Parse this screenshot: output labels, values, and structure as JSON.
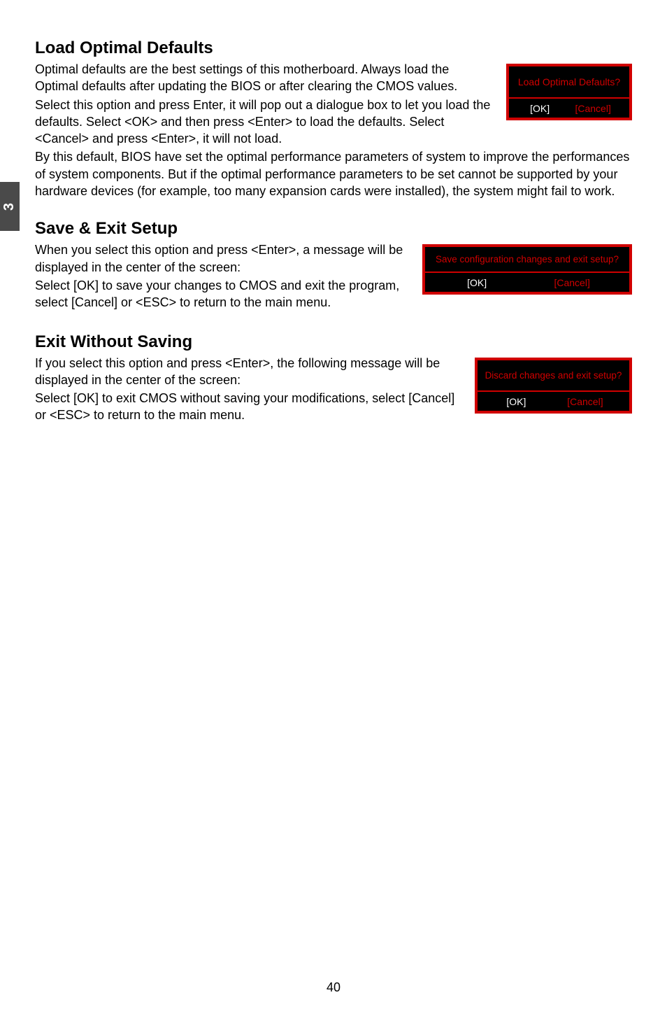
{
  "side_tab": "3",
  "page_number": "40",
  "section1": {
    "heading": "Load Optimal Defaults",
    "para1": "Optimal defaults are the best settings of this motherboard. Always load the Optimal defaults after updating the BIOS or after clearing the CMOS values.",
    "para2": "Select this option and press Enter, it will pop out a dialogue box to let you load the defaults. Select <OK> and then press <Enter> to load the defaults. Select <Cancel> and press <Enter>, it will not load.",
    "para3": "By this default, BIOS have set the optimal performance parameters of system to improve the performances of system components. But if the optimal performance parameters to be set cannot be supported by your hardware devices (for example, too many expansion cards were installed), the system might fail to work.",
    "dialog": {
      "title": "Load Optimal Defaults?",
      "ok": "[OK]",
      "cancel": "[Cancel]"
    }
  },
  "section2": {
    "heading": "Save & Exit Setup",
    "para1": "When you select this option and press <Enter>, a message will be displayed in the center of the screen:",
    "para2": "Select [OK] to save your changes to CMOS and exit the program, select [Cancel] or <ESC> to return to the main menu.",
    "dialog": {
      "title": "Save configuration changes and exit setup?",
      "ok": "[OK]",
      "cancel": "[Cancel]"
    }
  },
  "section3": {
    "heading": "Exit Without Saving",
    "para1": "If you select this option and press <Enter>, the following message will be displayed in the center of the screen:",
    "para2": "Select [OK] to exit CMOS without saving your modifications, select [Cancel] or <ESC> to return to the main menu.",
    "dialog": {
      "title": "Discard changes and exit setup?",
      "ok": "[OK]",
      "cancel": "[Cancel]"
    }
  }
}
